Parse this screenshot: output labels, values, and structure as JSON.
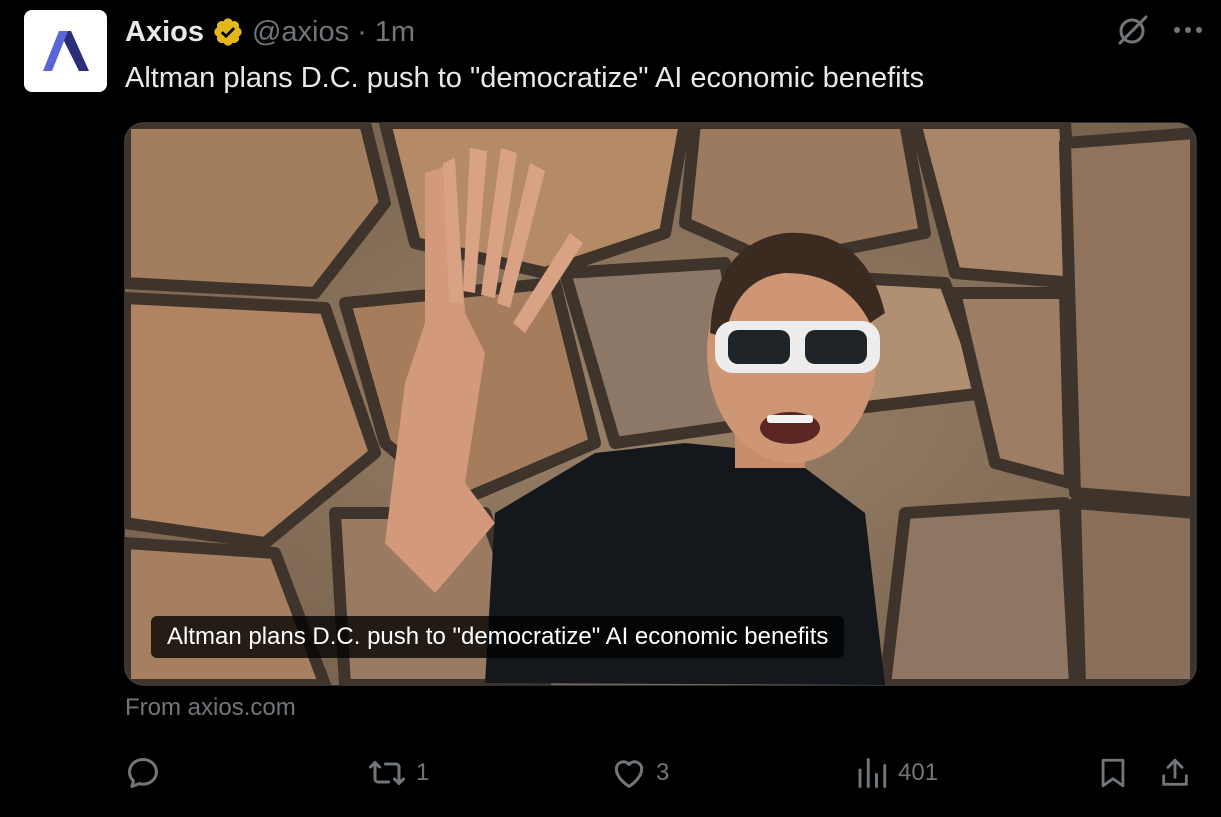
{
  "account": {
    "display_name": "Axios",
    "handle": "@axios",
    "separator": "·",
    "time": "1m",
    "avatar_icon": "axios-logo",
    "verified_icon": "verified-badge-icon",
    "verified_color": "#e2b719"
  },
  "tweet": {
    "text": "Altman plans D.C. push to \"democratize\" AI economic benefits"
  },
  "card": {
    "image_icon": "photo-person-waving",
    "caption": "Altman plans D.C. push to \"democratize\" AI economic benefits",
    "source": "From axios.com"
  },
  "top_actions": {
    "grok_icon": "grok-icon",
    "more_icon": "more-icon"
  },
  "actions": {
    "reply": {
      "icon": "reply-icon",
      "count": ""
    },
    "repost": {
      "icon": "repost-icon",
      "count": "1"
    },
    "like": {
      "icon": "like-icon",
      "count": "3"
    },
    "views": {
      "icon": "views-icon",
      "count": "401"
    },
    "bookmark": {
      "icon": "bookmark-icon"
    },
    "share": {
      "icon": "share-icon"
    }
  },
  "colors": {
    "background": "#000000",
    "text": "#e7e9ea",
    "muted": "#71767b",
    "brand_logo": "#5a64d6"
  }
}
